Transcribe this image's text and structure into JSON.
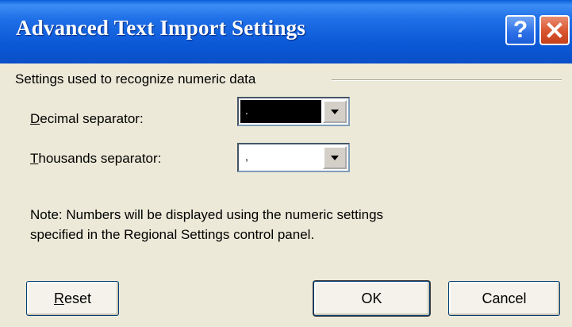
{
  "window": {
    "title": "Advanced Text Import Settings",
    "help_glyph": "?",
    "help_icon": "help-icon",
    "close_icon": "close-icon"
  },
  "group": {
    "label": "Settings used to recognize numeric data"
  },
  "decimal": {
    "label_mnemonic": "D",
    "label_rest": "ecimal separator:",
    "value": "."
  },
  "thousands": {
    "label_mnemonic": "T",
    "label_rest": "housands separator:",
    "value": ","
  },
  "note": {
    "line1": "Note: Numbers will be displayed using the numeric settings",
    "line2": "specified in the Regional Settings control panel."
  },
  "buttons": {
    "reset_mnemonic": "R",
    "reset_rest": "eset",
    "ok": "OK",
    "cancel": "Cancel"
  },
  "colors": {
    "titlebar": "#0b58d6",
    "dialog_bg": "#ece9d8",
    "close": "#d9542e",
    "selection": "#000000"
  }
}
